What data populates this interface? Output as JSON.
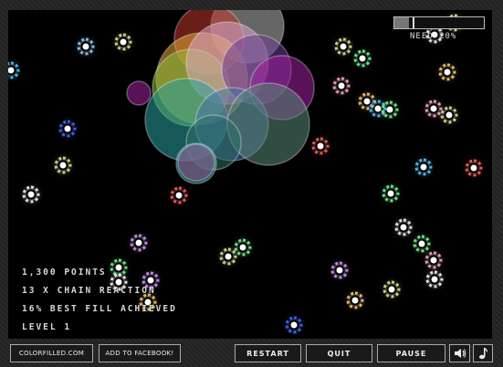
{
  "game": {
    "progress": {
      "label": "NEED 20%",
      "current_fill_fraction": 0.16,
      "target_fraction": 0.2
    },
    "stats": {
      "points": "1,300 POINTS",
      "chain": "13 X CHAIN REACTION",
      "best_fill": "16% BEST FILL ACHIEVED",
      "level": "LEVEL 1"
    },
    "circle_colors": [
      "#c0392b",
      "#e8a83a",
      "#8fbf3a",
      "#d7a5c8",
      "#6a3d8f",
      "#a020a0",
      "#2aa0a0",
      "#2e6f6a",
      "#5a8a78",
      "#9b4f88",
      "#4a6fa5",
      "#b9b9b9"
    ],
    "dot_colors": [
      "#e8e8a0",
      "#9fd3ff",
      "#ffb3c8",
      "#ff6666",
      "#d8a0ff",
      "#80ff9a",
      "#ffd080",
      "#ffffff",
      "#60c8ff",
      "#4a6bff"
    ]
  },
  "footer": {
    "site_link": "COLORFILLED.COM",
    "facebook_button": "ADD TO FACEBOOK!",
    "restart_button": "RESTART",
    "quit_button": "QUIT",
    "pause_button": "PAUSE",
    "sound_icon": "speaker-icon",
    "music_icon": "music-note-icon"
  }
}
